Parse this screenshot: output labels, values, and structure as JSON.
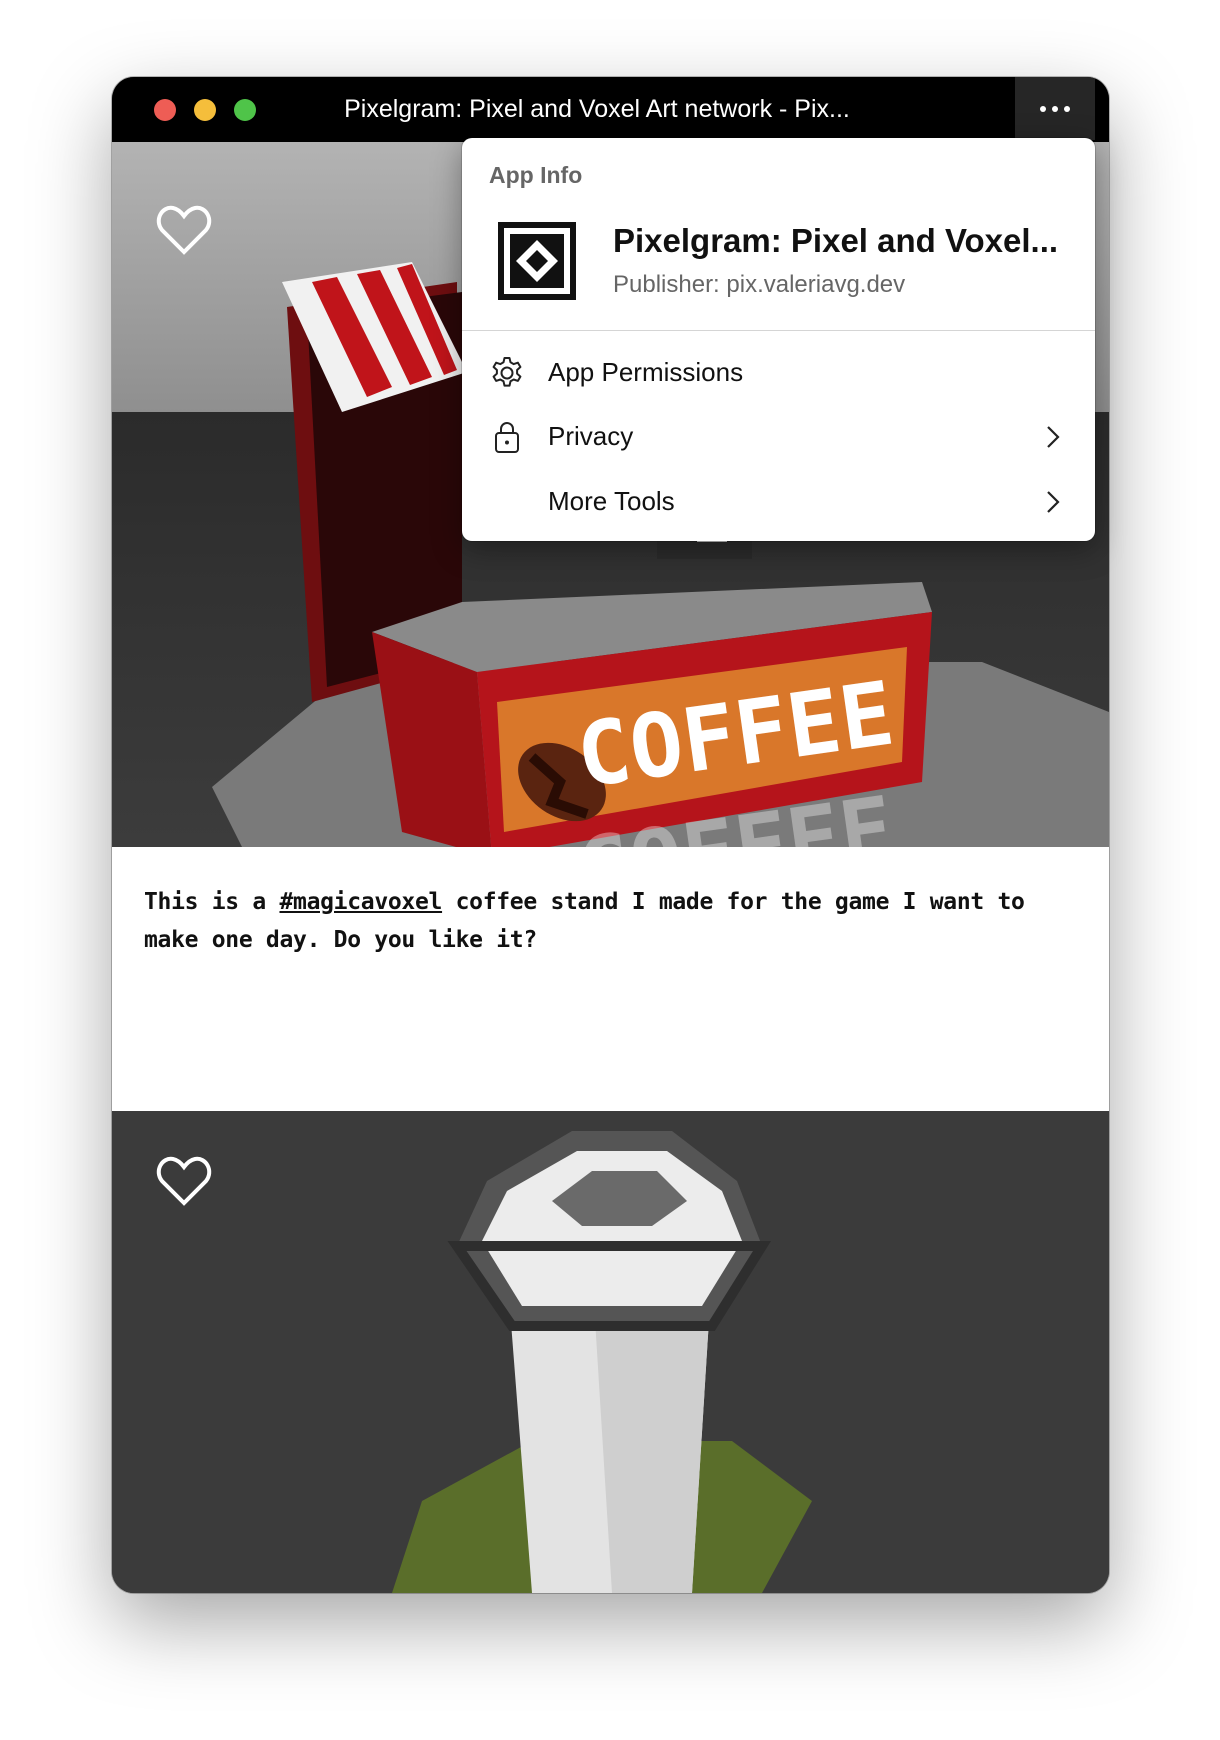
{
  "window": {
    "title": "Pixelgram: Pixel and Voxel Art network - Pix...",
    "more_icon": "ellipsis-icon"
  },
  "posts": [
    {
      "image_desc_icon": "heart-icon",
      "caption_before": "This is a ",
      "hashtag": "#magicavoxel",
      "caption_after": " coffee stand I made for the game I want to make one day. Do you like it?",
      "sign_text": "COFFEE"
    },
    {
      "image_desc_icon": "heart-icon"
    }
  ],
  "app_info": {
    "header": "App Info",
    "app_name": "Pixelgram: Pixel and Voxel...",
    "publisher": "Publisher: pix.valeriavg.dev",
    "items": [
      {
        "label": "App Permissions",
        "icon": "gear-icon",
        "has_submenu": false
      },
      {
        "label": "Privacy",
        "icon": "lock-icon",
        "has_submenu": true
      },
      {
        "label": "More Tools",
        "icon": "",
        "has_submenu": true
      }
    ]
  }
}
